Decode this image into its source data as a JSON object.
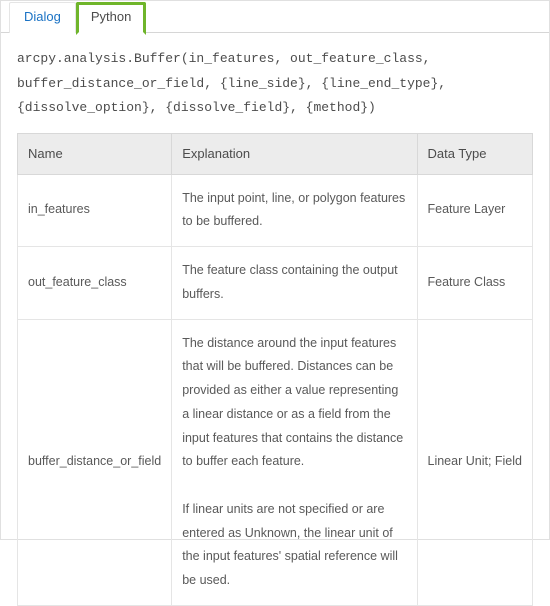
{
  "tabs": {
    "dialog": "Dialog",
    "python": "Python"
  },
  "syntax_line": "arcpy.analysis.Buffer(in_features, out_feature_class, buffer_distance_or_field, {line_side}, {line_end_type}, {dissolve_option}, {dissolve_field}, {method})",
  "table": {
    "headers": {
      "name": "Name",
      "explanation": "Explanation",
      "datatype": "Data Type"
    },
    "rows": [
      {
        "name": "in_features",
        "explanation": "The input point, line, or polygon features to be buffered.",
        "datatype": "Feature Layer"
      },
      {
        "name": "out_feature_class",
        "explanation": "The feature class containing the output buffers.",
        "datatype": "Feature Class"
      },
      {
        "name": "buffer_distance_or_field",
        "explanation": "The distance around the input features that will be buffered. Distances can be provided as either a value representing a linear distance or as a field from the input features that contains the distance to buffer each feature.\n\nIf linear units are not specified or are entered as Unknown, the linear unit of the input features' spatial reference will be used.",
        "datatype": "Linear Unit; Field"
      }
    ]
  }
}
